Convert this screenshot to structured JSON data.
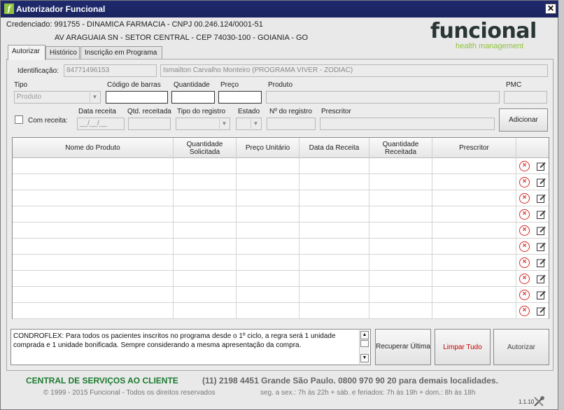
{
  "window": {
    "title": "Autorizador Funcional",
    "close": "✕"
  },
  "header": {
    "line1": "Credenciado: 991755 - DINAMICA FARMACIA - CNPJ 00.246.124/0001-51",
    "line2": "AV ARAGUAIA SN - SETOR CENTRAL - CEP 74030-100 - GOIANIA - GO"
  },
  "logo": {
    "word": "funcional",
    "tagline": "health management"
  },
  "tabs": [
    {
      "label": "Autorizar",
      "active": true
    },
    {
      "label": "Histórico",
      "active": false
    },
    {
      "label": "Inscrição em Programa",
      "active": false
    }
  ],
  "form": {
    "identificacao_label": "Identificação:",
    "identificacao_value": "84771496153",
    "paciente_value": "Ismailton Carvalho Monteiro (PROGRAMA VIVER - ZODIAC)",
    "tipo_label": "Tipo",
    "tipo_value": "Produto",
    "codigo_label": "Código de barras",
    "quantidade_label": "Quantidade",
    "preco_label": "Preço",
    "produto_label": "Produto",
    "pmc_label": "PMC",
    "com_receita_label": "Com receita:",
    "data_receita_label": "Data receita",
    "data_receita_placeholder": "__/__/__",
    "qtd_receitada_label": "Qtd. receitada",
    "tipo_registro_label": "Tipo do registro",
    "estado_label": "Estado",
    "n_registro_label": "Nº do registro",
    "prescritor_label": "Prescritor",
    "adicionar_label": "Adicionar"
  },
  "grid": {
    "columns": [
      "Nome do Produto",
      "Quantidade Solicitada",
      "Preço Unitário",
      "Data da Receita",
      "Quantidade Receitada",
      "Prescritor"
    ],
    "rows": 10
  },
  "message": "CONDROFLEX: Para todos os pacientes inscritos no programa desde o 1º ciclo, a regra será 1 unidade comprada e 1 unidade bonificada. Sempre considerando a mesma apresentação da compra.",
  "buttons": {
    "recuperar": "Recuperar Última",
    "limpar": "Limpar Tudo",
    "autorizar": "Autorizar"
  },
  "colors": {
    "limpar_text": "#cc0000",
    "footer_green": "#1c7a2f",
    "logo_green": "#8fc33d",
    "title_bar": "#1f2a6e"
  },
  "footer": {
    "central": "CENTRAL DE SERVIÇOS AO CLIENTE",
    "phone": "(11) 2198 4451 Grande São Paulo. 0800 970 90 20 para demais localidades.",
    "copyright": "© 1999 - 2015 Funcional - Todos os direitos reservados",
    "hours": "seg. a sex.: 7h às 22h + sáb. e feriados: 7h às 19h + dom.: 8h às 18h",
    "version": "1.1.10"
  }
}
